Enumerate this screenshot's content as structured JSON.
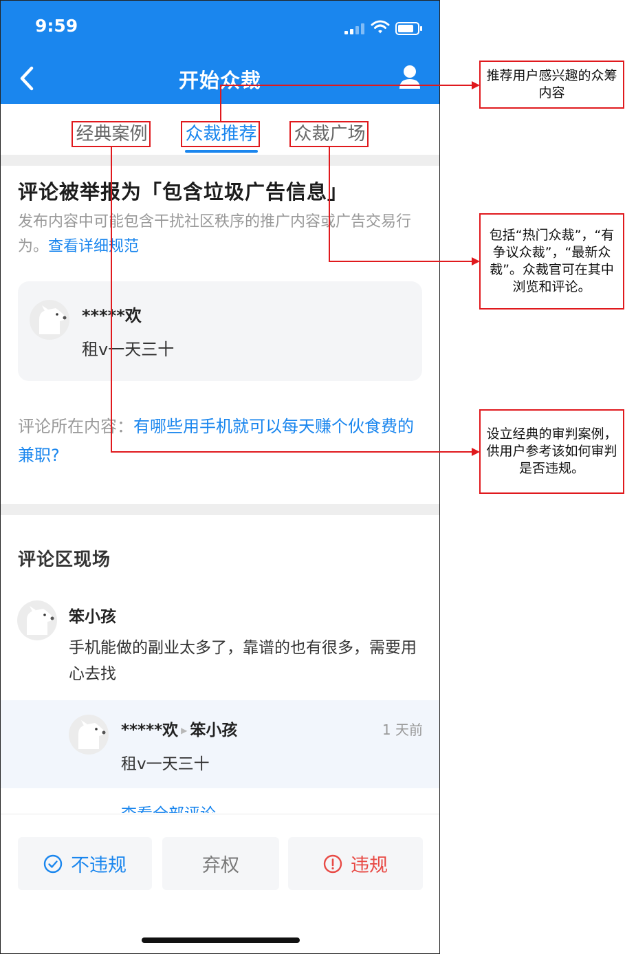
{
  "status_bar": {
    "time": "9:59"
  },
  "header": {
    "title": "开始众裁"
  },
  "tabs": [
    {
      "label": "经典案例"
    },
    {
      "label": "众裁推荐"
    },
    {
      "label": "众裁广场"
    }
  ],
  "report": {
    "title": "评论被举报为「包含垃圾广告信息」",
    "description": "发布内容中可能包含干扰社区秩序的推广内容或广告交易行为。",
    "link": "查看详细规范"
  },
  "reported_comment": {
    "user": "*****欢",
    "text": "租v一天三十"
  },
  "context": {
    "label": "评论所在内容：",
    "link": "有哪些用手机就可以每天赚个伙食费的兼职?"
  },
  "comments_section": {
    "heading": "评论区现场",
    "comment": {
      "user": "笨小孩",
      "text": "手机能做的副业太多了，靠谱的也有很多，需要用心去找"
    },
    "reply": {
      "from": "*****欢",
      "to": "笨小孩",
      "time": "1 天前",
      "text": "租v一天三十"
    },
    "view_all": "查看全部评论"
  },
  "actions": {
    "not_violate": "不违规",
    "abstain": "弃权",
    "violate": "违规"
  },
  "annotations": {
    "recommend_note": "推荐用户感兴趣的众筹内容",
    "square_note": "包括“热门众裁”，“有争议众裁”，“最新众裁”。众裁官可在其中浏览和评论。",
    "classic_note": "设立经典的审判案例，供用户参考该如何审判是否违规。"
  },
  "colors": {
    "brand_blue": "#1a86ee",
    "violate_red": "#e84a45",
    "annotation_red": "#e0191d"
  }
}
